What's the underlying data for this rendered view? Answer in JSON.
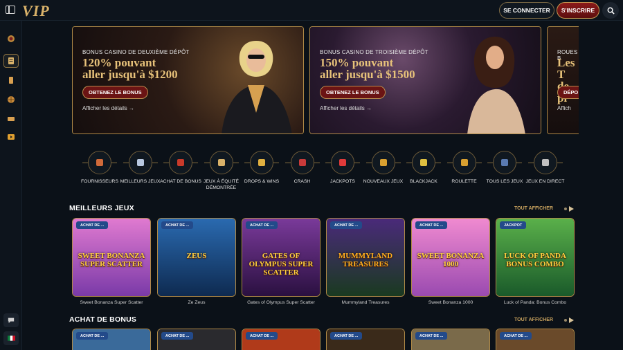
{
  "header": {
    "logo": "VIP",
    "login_label": "SE CONNECTER",
    "signup_label": "S'INSCRIRE"
  },
  "banners": [
    {
      "kicker": "BONUS CASINO DE DEUXIÈME DÉPÔT",
      "line1": "120% pouvant",
      "line2": "aller jusqu'à $1200",
      "cta": "OBTENEZ LE BONUS",
      "details": "Afficher les détails →"
    },
    {
      "kicker": "BONUS CASINO DE TROISIÈME DÉPÔT",
      "line1": "150% pouvant",
      "line2": "aller jusqu'à $1500",
      "cta": "OBTENEZ LE BONUS",
      "details": "Afficher les détails →"
    },
    {
      "kicker": "ROUES B",
      "line1": "Les T",
      "line2": "de pl",
      "cta": "DÉPO",
      "details": "Affich"
    }
  ],
  "categories": [
    {
      "label": "FOURNISSEURS",
      "icon": "book-icon"
    },
    {
      "label": "MEILLEURS JEUX",
      "icon": "diamond-icon"
    },
    {
      "label": "ACHAT DE BONUS",
      "icon": "gift-icon"
    },
    {
      "label": "JEUX À ÉQUITÉ DÉMONTRÉE",
      "icon": "scales-icon"
    },
    {
      "label": "DROPS & WINS",
      "icon": "trophy-icon"
    },
    {
      "label": "CRASH",
      "icon": "rocket-icon"
    },
    {
      "label": "JACKPOTS",
      "icon": "seven-icon"
    },
    {
      "label": "NOUVEAUX JEUX",
      "icon": "bell-icon"
    },
    {
      "label": "BLACKJACK",
      "icon": "chip-icon"
    },
    {
      "label": "ROULETTE",
      "icon": "roulette-icon"
    },
    {
      "label": "TOUS LES JEUX",
      "icon": "slot-icon"
    },
    {
      "label": "JEUX EN DIRECT",
      "icon": "microphone-icon"
    }
  ],
  "best_games": {
    "title": "MEILLEURS JEUX",
    "view_all": "TOUT AFFICHER",
    "games": [
      {
        "badge": "ACHAT DE ...",
        "name": "Sweet Bonanza Super Scatter",
        "art": "SWEET BONANZA SUPER SCATTER"
      },
      {
        "badge": "ACHAT DE ...",
        "name": "Ze Zeus",
        "art": "ZEUS"
      },
      {
        "badge": "ACHAT DE ...",
        "name": "Gates of Olympus Super Scatter",
        "art": "GATES OF OLYMPUS SUPER SCATTER"
      },
      {
        "badge": "ACHAT DE ...",
        "name": "Mummyland Treasures",
        "art": "MUMMYLAND TREASURES"
      },
      {
        "badge": "ACHAT DE ...",
        "name": "Sweet Bonanza 1000",
        "art": "SWEET BONANZA 1000"
      },
      {
        "badge": "JACKPOT",
        "name": "Luck of Panda: Bonus Combo",
        "art": "LUCK OF PANDA BONUS COMBO"
      }
    ]
  },
  "bonus_buy": {
    "title": "ACHAT DE BONUS",
    "view_all": "TOUT AFFICHER",
    "badges": [
      "ACHAT DE ...",
      "ACHAT DE ...",
      "ACHAT DE ...",
      "ACHAT DE ...",
      "ACHAT DE ...",
      "ACHAT DE ..."
    ]
  },
  "colors": {
    "background": "#0b1118",
    "gold": "#c9a35e",
    "signup_red": "#8b1a1a",
    "badge_blue": "#234a8a"
  }
}
